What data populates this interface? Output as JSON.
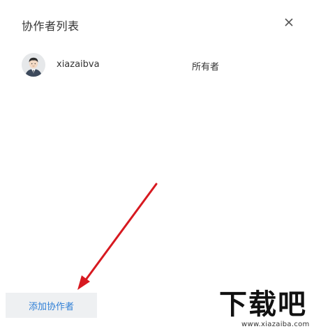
{
  "dialog": {
    "title": "协作者列表",
    "close_icon": "close-icon"
  },
  "collaborators": [
    {
      "name": "xiazaibva",
      "role": "所有者",
      "avatar_icon": "user-avatar-icon"
    }
  ],
  "actions": {
    "add_label": "添加协作者"
  },
  "annotation": {
    "arrow_color": "#d71920"
  },
  "watermark": {
    "brand": "下载吧",
    "url": "www.xiazaiba.com"
  },
  "colors": {
    "accent": "#2f7fd6",
    "button_bg": "#eef0f2"
  }
}
